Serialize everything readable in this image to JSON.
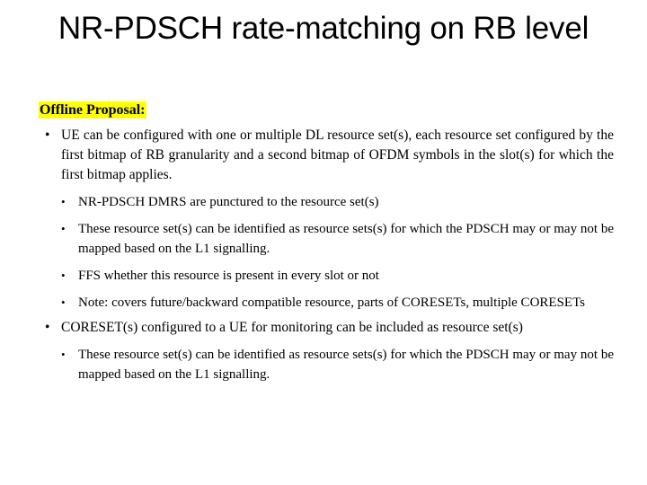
{
  "slide": {
    "title": "NR-PDSCH rate-matching on RB level",
    "highlight_color": "#FFFF00",
    "background_color": "#FFFFFF",
    "text_color": "#000000",
    "headline": "Offline Proposal:",
    "bullet_glyph": "•",
    "content": {
      "b1_1": "UE can be configured with one or multiple DL resource set(s), each resource set configured by the first bitmap of RB granularity and a second bitmap of OFDM symbols in the slot(s) for which the first bitmap applies.",
      "b2_1": "NR-PDSCH DMRS are punctured to the resource set(s)",
      "b2_2": "These resource set(s) can be identified as resource sets(s) for which the PDSCH may or may not be mapped based on the L1 signalling.",
      "b2_3": "FFS whether this resource is present in every slot or not",
      "b2_4": "Note: covers future/backward compatible resource, parts of CORESETs, multiple CORESETs",
      "b1_2": "CORESET(s) configured to a UE for monitoring can be included as resource set(s)",
      "b2_5": "These resource set(s) can be identified as resource sets(s) for which the PDSCH may or may not be mapped based on the L1 signalling."
    }
  }
}
